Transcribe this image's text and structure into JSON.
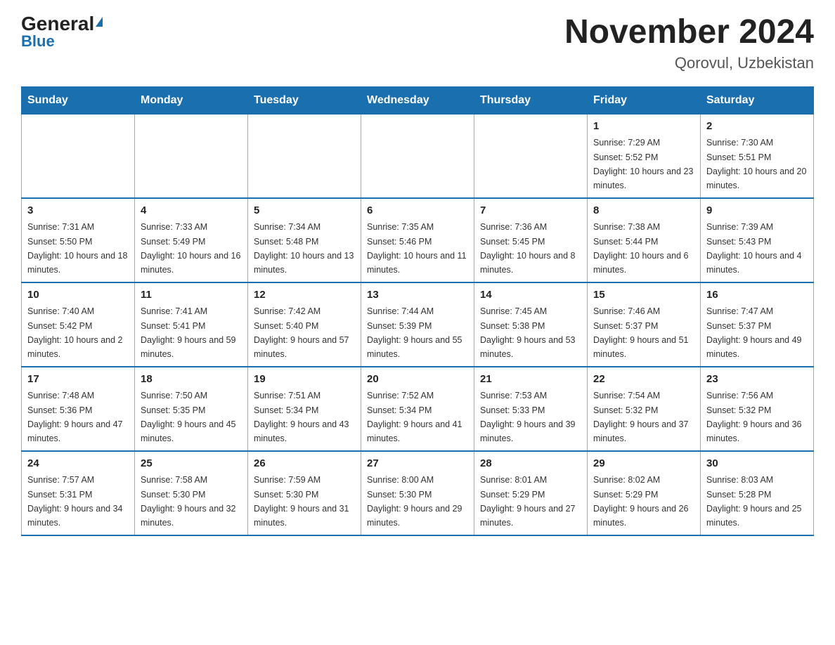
{
  "header": {
    "logo_general": "General",
    "logo_blue": "Blue",
    "title": "November 2024",
    "location": "Qorovul, Uzbekistan"
  },
  "calendar": {
    "days_of_week": [
      "Sunday",
      "Monday",
      "Tuesday",
      "Wednesday",
      "Thursday",
      "Friday",
      "Saturday"
    ],
    "weeks": [
      [
        {
          "day": "",
          "info": ""
        },
        {
          "day": "",
          "info": ""
        },
        {
          "day": "",
          "info": ""
        },
        {
          "day": "",
          "info": ""
        },
        {
          "day": "",
          "info": ""
        },
        {
          "day": "1",
          "info": "Sunrise: 7:29 AM\nSunset: 5:52 PM\nDaylight: 10 hours and 23 minutes."
        },
        {
          "day": "2",
          "info": "Sunrise: 7:30 AM\nSunset: 5:51 PM\nDaylight: 10 hours and 20 minutes."
        }
      ],
      [
        {
          "day": "3",
          "info": "Sunrise: 7:31 AM\nSunset: 5:50 PM\nDaylight: 10 hours and 18 minutes."
        },
        {
          "day": "4",
          "info": "Sunrise: 7:33 AM\nSunset: 5:49 PM\nDaylight: 10 hours and 16 minutes."
        },
        {
          "day": "5",
          "info": "Sunrise: 7:34 AM\nSunset: 5:48 PM\nDaylight: 10 hours and 13 minutes."
        },
        {
          "day": "6",
          "info": "Sunrise: 7:35 AM\nSunset: 5:46 PM\nDaylight: 10 hours and 11 minutes."
        },
        {
          "day": "7",
          "info": "Sunrise: 7:36 AM\nSunset: 5:45 PM\nDaylight: 10 hours and 8 minutes."
        },
        {
          "day": "8",
          "info": "Sunrise: 7:38 AM\nSunset: 5:44 PM\nDaylight: 10 hours and 6 minutes."
        },
        {
          "day": "9",
          "info": "Sunrise: 7:39 AM\nSunset: 5:43 PM\nDaylight: 10 hours and 4 minutes."
        }
      ],
      [
        {
          "day": "10",
          "info": "Sunrise: 7:40 AM\nSunset: 5:42 PM\nDaylight: 10 hours and 2 minutes."
        },
        {
          "day": "11",
          "info": "Sunrise: 7:41 AM\nSunset: 5:41 PM\nDaylight: 9 hours and 59 minutes."
        },
        {
          "day": "12",
          "info": "Sunrise: 7:42 AM\nSunset: 5:40 PM\nDaylight: 9 hours and 57 minutes."
        },
        {
          "day": "13",
          "info": "Sunrise: 7:44 AM\nSunset: 5:39 PM\nDaylight: 9 hours and 55 minutes."
        },
        {
          "day": "14",
          "info": "Sunrise: 7:45 AM\nSunset: 5:38 PM\nDaylight: 9 hours and 53 minutes."
        },
        {
          "day": "15",
          "info": "Sunrise: 7:46 AM\nSunset: 5:37 PM\nDaylight: 9 hours and 51 minutes."
        },
        {
          "day": "16",
          "info": "Sunrise: 7:47 AM\nSunset: 5:37 PM\nDaylight: 9 hours and 49 minutes."
        }
      ],
      [
        {
          "day": "17",
          "info": "Sunrise: 7:48 AM\nSunset: 5:36 PM\nDaylight: 9 hours and 47 minutes."
        },
        {
          "day": "18",
          "info": "Sunrise: 7:50 AM\nSunset: 5:35 PM\nDaylight: 9 hours and 45 minutes."
        },
        {
          "day": "19",
          "info": "Sunrise: 7:51 AM\nSunset: 5:34 PM\nDaylight: 9 hours and 43 minutes."
        },
        {
          "day": "20",
          "info": "Sunrise: 7:52 AM\nSunset: 5:34 PM\nDaylight: 9 hours and 41 minutes."
        },
        {
          "day": "21",
          "info": "Sunrise: 7:53 AM\nSunset: 5:33 PM\nDaylight: 9 hours and 39 minutes."
        },
        {
          "day": "22",
          "info": "Sunrise: 7:54 AM\nSunset: 5:32 PM\nDaylight: 9 hours and 37 minutes."
        },
        {
          "day": "23",
          "info": "Sunrise: 7:56 AM\nSunset: 5:32 PM\nDaylight: 9 hours and 36 minutes."
        }
      ],
      [
        {
          "day": "24",
          "info": "Sunrise: 7:57 AM\nSunset: 5:31 PM\nDaylight: 9 hours and 34 minutes."
        },
        {
          "day": "25",
          "info": "Sunrise: 7:58 AM\nSunset: 5:30 PM\nDaylight: 9 hours and 32 minutes."
        },
        {
          "day": "26",
          "info": "Sunrise: 7:59 AM\nSunset: 5:30 PM\nDaylight: 9 hours and 31 minutes."
        },
        {
          "day": "27",
          "info": "Sunrise: 8:00 AM\nSunset: 5:30 PM\nDaylight: 9 hours and 29 minutes."
        },
        {
          "day": "28",
          "info": "Sunrise: 8:01 AM\nSunset: 5:29 PM\nDaylight: 9 hours and 27 minutes."
        },
        {
          "day": "29",
          "info": "Sunrise: 8:02 AM\nSunset: 5:29 PM\nDaylight: 9 hours and 26 minutes."
        },
        {
          "day": "30",
          "info": "Sunrise: 8:03 AM\nSunset: 5:28 PM\nDaylight: 9 hours and 25 minutes."
        }
      ]
    ]
  }
}
